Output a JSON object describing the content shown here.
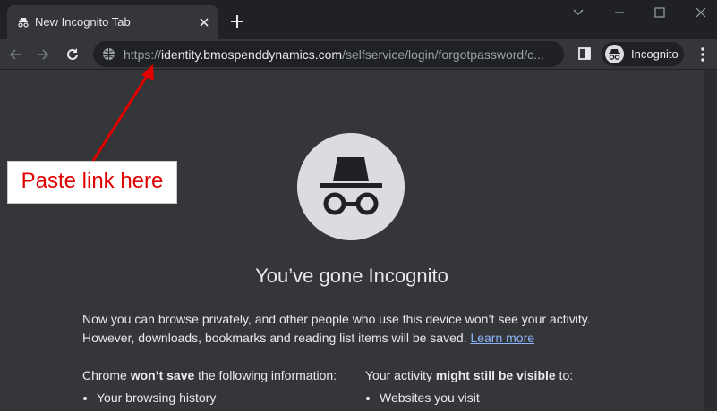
{
  "tab": {
    "title": "New Incognito Tab"
  },
  "address_bar": {
    "scheme": "https://",
    "host": "identity.bmospenddynamics.com",
    "path": "/selfservice/login/forgotpassword/c..."
  },
  "profile": {
    "label": "Incognito"
  },
  "page": {
    "headline": "You’ve gone Incognito",
    "intro_line1": "Now you can browse privately, and other people who use this device won’t see your activity.",
    "intro_line2": "However, downloads, bookmarks and reading list items will be saved.",
    "learn_more": "Learn more",
    "left_column": {
      "lead": "Chrome ",
      "emphasis": "won’t save",
      "rest": " the following information:",
      "items": [
        "Your browsing history"
      ]
    },
    "right_column": {
      "lead": "Your activity ",
      "emphasis": "might still be visible",
      "rest": " to:",
      "items": [
        "Websites you visit"
      ]
    }
  },
  "annotation": {
    "text": "Paste link here",
    "color": "#e00000"
  },
  "colors": {
    "frame": "#202124",
    "toolbar": "#35363a",
    "link": "#8ab4f8",
    "text": "#e8eaed",
    "dim_text": "#9aa0a6"
  }
}
